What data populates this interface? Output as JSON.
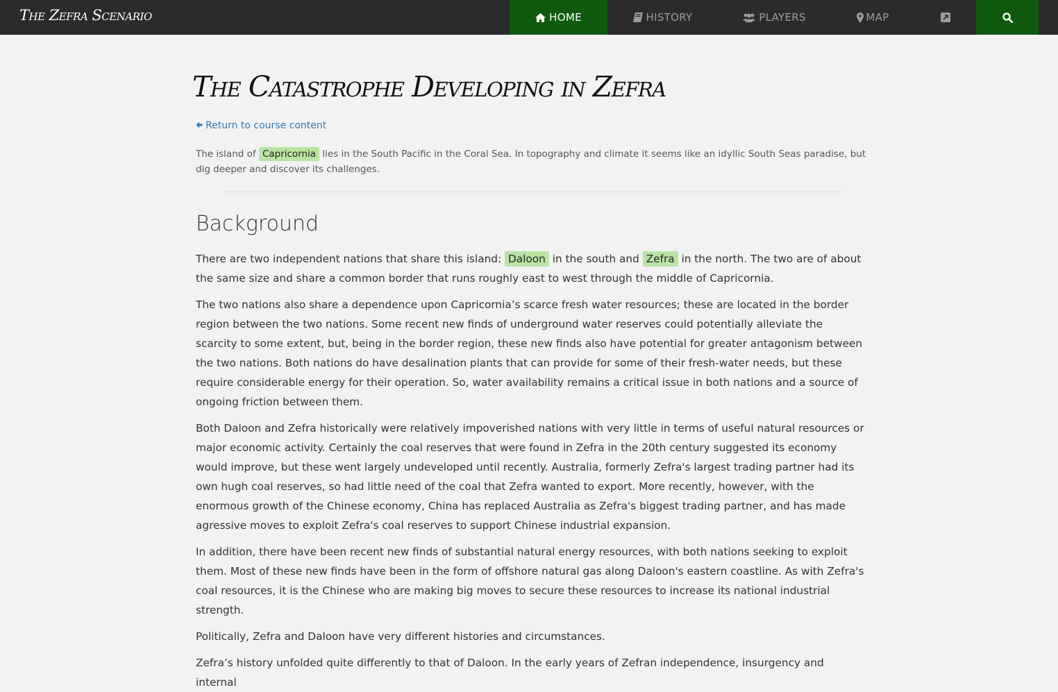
{
  "navbar": {
    "brand": "The Zefra Scenario",
    "items": [
      {
        "label": "HOME",
        "icon": "home-icon",
        "active": true
      },
      {
        "label": "HISTORY",
        "icon": "book-icon",
        "active": false
      },
      {
        "label": "PLAYERS",
        "icon": "users-icon",
        "active": false
      },
      {
        "label": "MAP",
        "icon": "map-marker-icon",
        "active": false
      },
      {
        "label": "",
        "icon": "external-link-icon",
        "active": false
      },
      {
        "label": "",
        "icon": "search-icon",
        "active": true
      }
    ],
    "colors": {
      "background": "#2b2b2b",
      "active": "#0f5a0f",
      "text": "#9d9d9d"
    }
  },
  "page": {
    "title": "The Catastrophe Developing in Zefra",
    "return_link": "Return to course content",
    "intro": {
      "before": "The island of ",
      "highlight": "Capricornia",
      "after": " lies in the South Pacific in the Coral Sea. In topography and climate it seems like an idyllic South Seas paradise, but dig deeper and discover its challenges."
    },
    "section_heading": "Background",
    "p1": {
      "before": "There are two independent nations that share this island: ",
      "highlight1": "Daloon",
      "middle": " in the south and ",
      "highlight2": "Zefra",
      "after": " in the north. The two are of about the same size and share a common border that runs roughly east to west through the middle of Capricornia."
    },
    "p2": "The two nations also share a dependence upon Capricornia’s scarce fresh water resources; these are located in the border region between the two nations. Some recent new finds of underground water reserves could potentially alleviate the scarcity to some extent, but, being in the border region, these new finds also have potential for greater antagonism between the two nations. Both nations do have desalination plants that can provide for some of their fresh-water needs, but these require considerable energy for their operation. So, water availability remains a critical issue in both nations and a source of ongoing friction between them.",
    "p3": "Both Daloon and Zefra historically were relatively impoverished nations with very little in terms of useful natural resources or major economic activity. Certainly the coal reserves that were found in Zefra in the 20th century suggested its economy would improve, but these went largely undeveloped until recently. Australia, formerly Zefra's largest trading partner had its own hugh coal reserves, so had little need of the coal that Zefra wanted to export. More recently, however, with the enormous growth of the Chinese economy, China has replaced Australia as Zefra's biggest trading partner, and has made agressive moves to exploit Zefra's coal reserves to support Chinese industrial expansion.",
    "p4": "In addition, there have been recent new finds of substantial natural energy resources, with both nations seeking to exploit them. Most of these new finds have been in the form of offshore natural gas along Daloon's eastern coastline. As with Zefra's coal resources, it is the Chinese who are making big moves to secure these resources to increase its national industrial strength.",
    "p5": "Politically, Zefra and Daloon have very different histories and circumstances.",
    "p6": "Zefra’s history unfolded quite differently to that of Daloon. In the early years of Zefran independence, insurgency and internal",
    "highlight_color": "#b9e4a4",
    "link_color": "#337ab7"
  }
}
